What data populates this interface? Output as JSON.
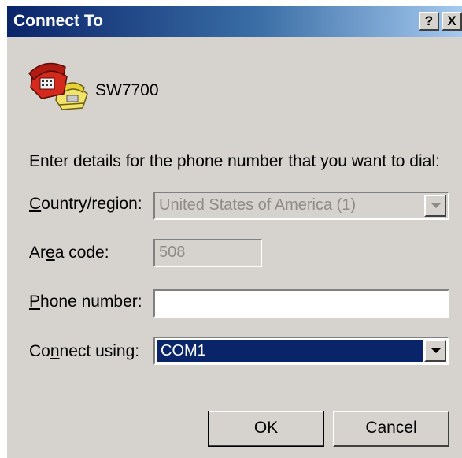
{
  "window": {
    "title": "Connect To",
    "help_label": "?",
    "close_label": "X"
  },
  "connection": {
    "name": "SW7700",
    "icon": "phone-connection-icon"
  },
  "instruction": "Enter details for the phone number that you want to dial:",
  "form": {
    "country": {
      "label_pre": "",
      "label_u": "C",
      "label_post": "ountry/region:",
      "value": "United States of America (1)",
      "enabled": false
    },
    "area_code": {
      "label_pre": "Ar",
      "label_u": "e",
      "label_post": "a code:",
      "value": "508",
      "enabled": false
    },
    "phone_number": {
      "label_pre": "",
      "label_u": "P",
      "label_post": "hone number:",
      "value": "",
      "enabled": true
    },
    "connect_using": {
      "label_pre": "Co",
      "label_u": "n",
      "label_post": "nect using:",
      "value": "COM1",
      "enabled": true
    }
  },
  "buttons": {
    "ok": "OK",
    "cancel": "Cancel"
  },
  "colors": {
    "titlebar_start": "#0a246a",
    "titlebar_end": "#a6caf0",
    "face": "#d6d3ce",
    "selection": "#0a246a"
  }
}
